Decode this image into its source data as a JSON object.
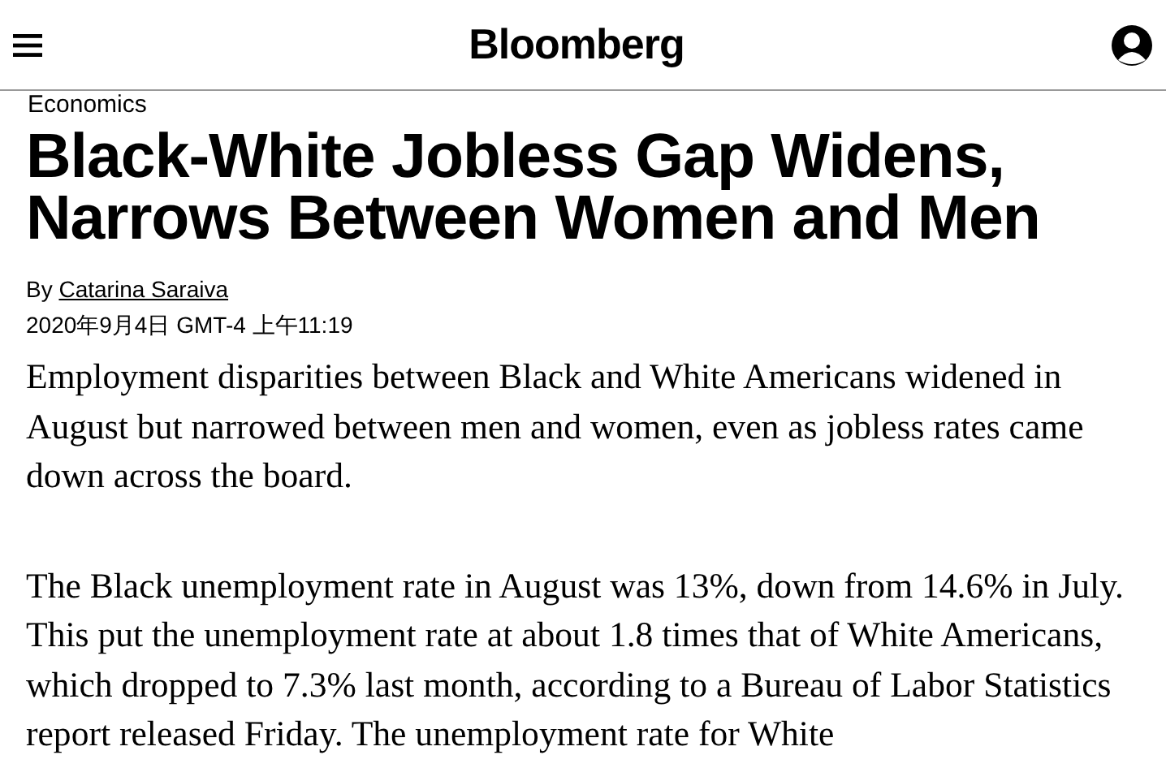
{
  "header": {
    "logo": "Bloomberg"
  },
  "section": "Economics",
  "headline": "Black-White Jobless Gap Widens, Narrows Between Women and Men",
  "byline": {
    "prefix": "By",
    "author": "Catarina Saraiva"
  },
  "timestamp": "2020年9月4日 GMT-4 上午11:19",
  "paragraphs": [
    "Employment disparities between Black and White Americans widened in August but narrowed between men and women, even as jobless rates came down across the board.",
    "The Black unemployment rate in August was 13%, down from 14.6% in July. This put the unemployment rate at about 1.8 times that of White Americans, which dropped to 7.3% last month, according to a Bureau of Labor Statistics report released Friday. The unemployment rate for White"
  ]
}
